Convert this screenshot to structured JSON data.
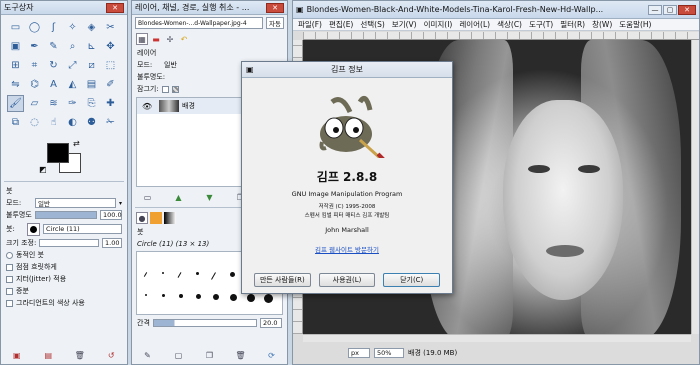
{
  "toolbox": {
    "title": "도구상자",
    "tool_icons": [
      "rect-select",
      "ellipse-select",
      "free-select",
      "fuzzy-select",
      "color-select",
      "scissors",
      "foreground-select",
      "paths",
      "color-picker",
      "zoom",
      "measure",
      "move",
      "align",
      "crop",
      "rotate",
      "scale",
      "shear",
      "perspective",
      "flip",
      "cage",
      "text",
      "bucket-fill",
      "blend",
      "pencil",
      "paintbrush",
      "eraser",
      "airbrush",
      "ink",
      "clone",
      "heal",
      "perspective-clone",
      "blur",
      "smudge",
      "dodge",
      "gimp-head",
      "scissors2"
    ],
    "tool_options": {
      "section": "붓",
      "mode_label": "모드:",
      "mode_value": "일반",
      "opacity_label": "불투명도",
      "opacity_value": "100.0",
      "brush_label": "붓:",
      "brush_value": "Circle (11)",
      "size_label": "크기 조정:",
      "size_value": "1.00",
      "dynamics_label": "동적인 붓",
      "fade_label": "점점 흐릿하게",
      "jitter_label": "지터(Jitter) 적용",
      "smooth_label": "증분",
      "gradient_label": "그라디언트의 색상 사용"
    }
  },
  "layers": {
    "title": "레이어, 채널, 경로, 실행 취소 - ...",
    "image_selector": "Blondes-Women-...d-Wallpaper.jpg-4",
    "auto_label": "자동",
    "section_label": "레이어",
    "mode_label": "모드:",
    "mode_value": "일반",
    "opacity_label": "불투명도:",
    "lock_label": "잠그기:",
    "layer_name": "배경",
    "brushes_section": "붓",
    "brush_info": "Circle (11) (13 × 13)",
    "spacing_label": "간격",
    "spacing_value": "20.0"
  },
  "image_window": {
    "title": "Blondes-Women-Black-And-White-Models-Tina-Karol-Fresh-New-Hd-Wallp...",
    "menu": [
      "파일(F)",
      "편집(E)",
      "선택(S)",
      "보기(V)",
      "이미지(I)",
      "레이어(L)",
      "색상(C)",
      "도구(T)",
      "필터(R)",
      "창(W)",
      "도움말(H)"
    ],
    "unit": "px",
    "zoom": "50%",
    "status": "배경 (19.0 MB)"
  },
  "about": {
    "title": "김프 정보",
    "app_name": "김프 2.8.8",
    "subtitle": "GNU Image Manipulation Program",
    "copyright": "저작권 (C) 1995-2008",
    "team": "스펜서 킴벌 피터 매티스 김프 개발팀",
    "author": "John Marshall",
    "link": "김프 웹사이트 방문하기",
    "credits_button": "만든 사람들(R)",
    "license_button": "사용권(L)",
    "close_button": "닫기(C)"
  },
  "colors": {
    "accent": "#2e5e9a",
    "fg_color": "#000000",
    "bg_color": "#ffffff"
  }
}
